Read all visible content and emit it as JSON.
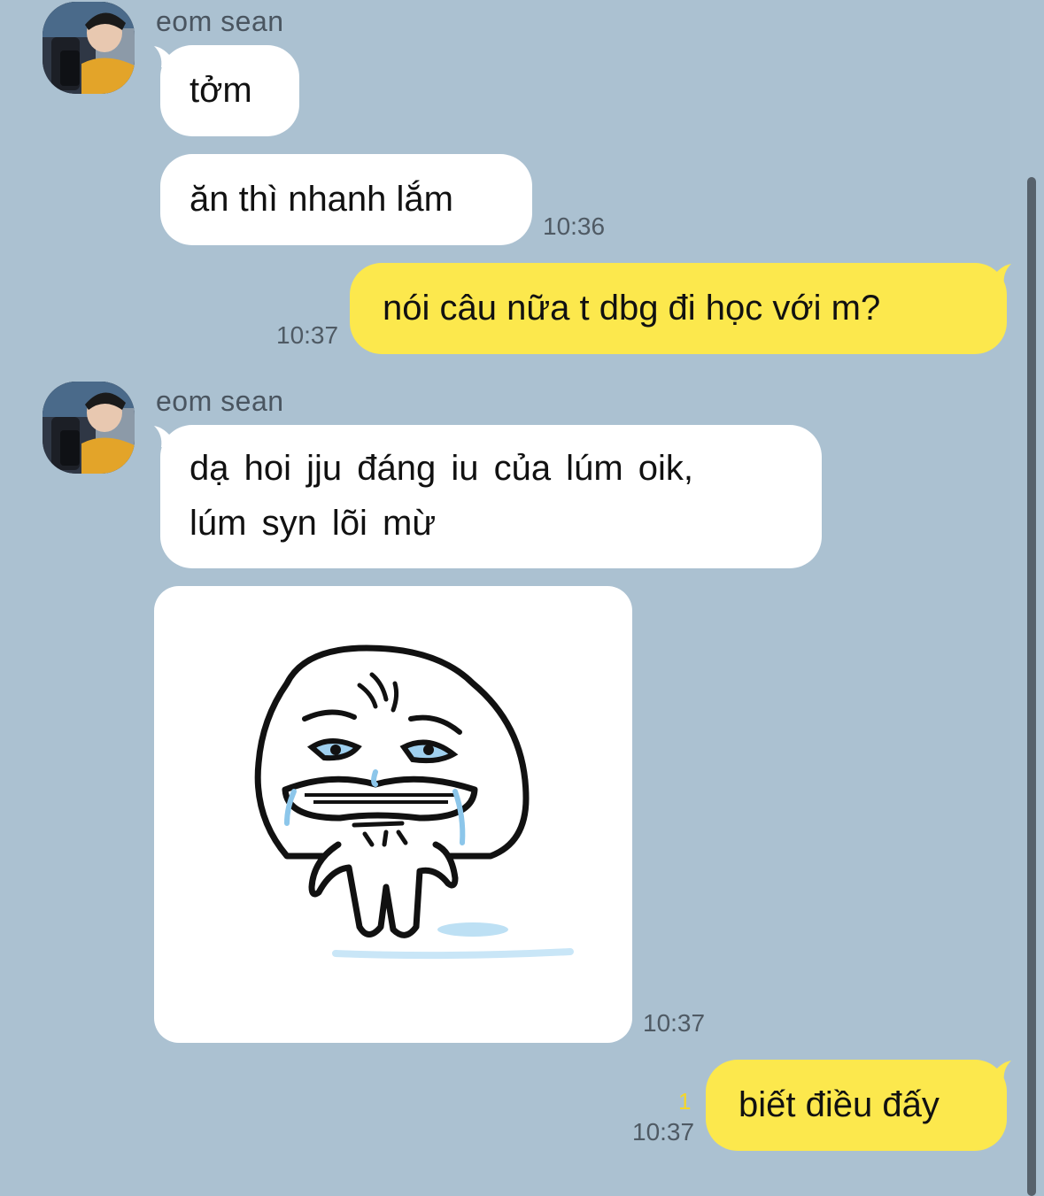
{
  "conversation": {
    "sender_name_1": "eom sean",
    "msg_1": "tởm",
    "msg_2": "ăn thì nhanh lắm",
    "time_1": "10:36",
    "reply_1": "nói câu nữa t dbg đi học với m?",
    "time_2": "10:37",
    "sender_name_2": "eom sean",
    "msg_3_line1": "dạ hoi jju đáng iu của lúm oik,",
    "msg_3_line2": "lúm syn lõi mừ",
    "time_3": "10:37",
    "unread_count": "1",
    "reply_2": "biết điều đấy",
    "time_4": "10:37"
  },
  "colors": {
    "background": "#abc1d1",
    "incoming_bubble": "#ffffff",
    "outgoing_bubble": "#fce84d",
    "unread_badge": "#f4d62a"
  },
  "icons": {
    "avatar": "profile-photo",
    "sticker": "crying-blob-sticker"
  }
}
